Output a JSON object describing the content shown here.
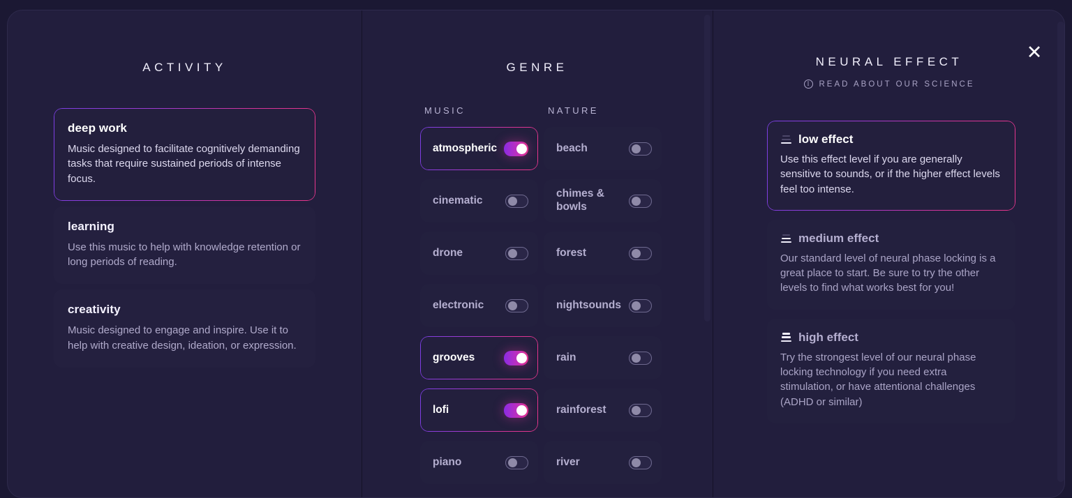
{
  "modal": {
    "close_label": "✕"
  },
  "activity": {
    "title": "ACTIVITY",
    "items": [
      {
        "name": "deep work",
        "desc": "Music designed to facilitate cognitively demanding tasks that require sustained periods of intense focus.",
        "selected": true
      },
      {
        "name": "learning",
        "desc": "Use this music to help with knowledge retention or long periods of reading.",
        "selected": false
      },
      {
        "name": "creativity",
        "desc": "Music designed to engage and inspire. Use it to help with creative design, ideation, or expression.",
        "selected": false
      }
    ]
  },
  "genre": {
    "title": "GENRE",
    "groups": [
      {
        "label": "MUSIC",
        "items": [
          {
            "name": "atmospheric",
            "on": true
          },
          {
            "name": "cinematic",
            "on": false
          },
          {
            "name": "drone",
            "on": false
          },
          {
            "name": "electronic",
            "on": false
          },
          {
            "name": "grooves",
            "on": true
          },
          {
            "name": "lofi",
            "on": true
          },
          {
            "name": "piano",
            "on": false
          }
        ]
      },
      {
        "label": "NATURE",
        "items": [
          {
            "name": "beach",
            "on": false
          },
          {
            "name": "chimes & bowls",
            "on": false
          },
          {
            "name": "forest",
            "on": false
          },
          {
            "name": "nightsounds",
            "on": false
          },
          {
            "name": "rain",
            "on": false
          },
          {
            "name": "rainforest",
            "on": false
          },
          {
            "name": "river",
            "on": false
          }
        ]
      }
    ]
  },
  "neural": {
    "title": "NEURAL EFFECT",
    "science_link": "READ ABOUT OUR SCIENCE",
    "items": [
      {
        "name": "low effect",
        "level": 1,
        "desc": "Use this effect level if you are generally sensitive to sounds, or if the higher effect levels feel too intense.",
        "selected": true
      },
      {
        "name": "medium effect",
        "level": 2,
        "desc": "Our standard level of neural phase locking is a great place to start. Be sure to try the other levels to find what works best for you!",
        "selected": false
      },
      {
        "name": "high effect",
        "level": 3,
        "desc": "Try the strongest level of our neural phase locking technology if you need extra stimulation, or have attentional challenges (ADHD or similar)",
        "selected": false
      }
    ]
  },
  "colors": {
    "background": "#1b1833",
    "surface": "#221e3d",
    "accent_start": "#7b3fe4",
    "accent_end": "#e8368c"
  }
}
